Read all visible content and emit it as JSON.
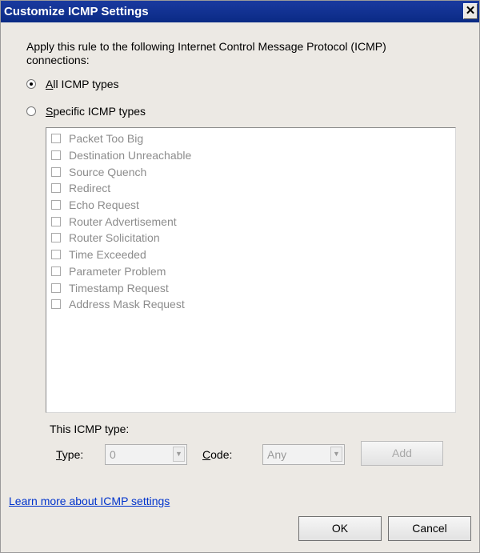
{
  "window": {
    "title": "Customize ICMP Settings",
    "close_glyph": "✕"
  },
  "description": "Apply this rule to the following Internet Control Message Protocol (ICMP) connections:",
  "radios": [
    {
      "accel": "A",
      "rest": "ll ICMP types",
      "selected": true
    },
    {
      "accel": "S",
      "rest": "pecific ICMP types",
      "selected": false
    }
  ],
  "icmp_types": [
    "Packet Too Big",
    "Destination Unreachable",
    "Source Quench",
    "Redirect",
    "Echo Request",
    "Router Advertisement",
    "Router Solicitation",
    "Time Exceeded",
    "Parameter Problem",
    "Timestamp Request",
    "Address Mask Request"
  ],
  "this_type": {
    "section_label": "This ICMP type:",
    "type_accel": "T",
    "type_rest": "ype:",
    "type_value": "0",
    "code_accel": "C",
    "code_rest": "ode:",
    "code_value": "Any",
    "add_label": "Add"
  },
  "learn_more_link": "Learn more about ICMP settings",
  "buttons": {
    "ok": "OK",
    "cancel": "Cancel"
  }
}
